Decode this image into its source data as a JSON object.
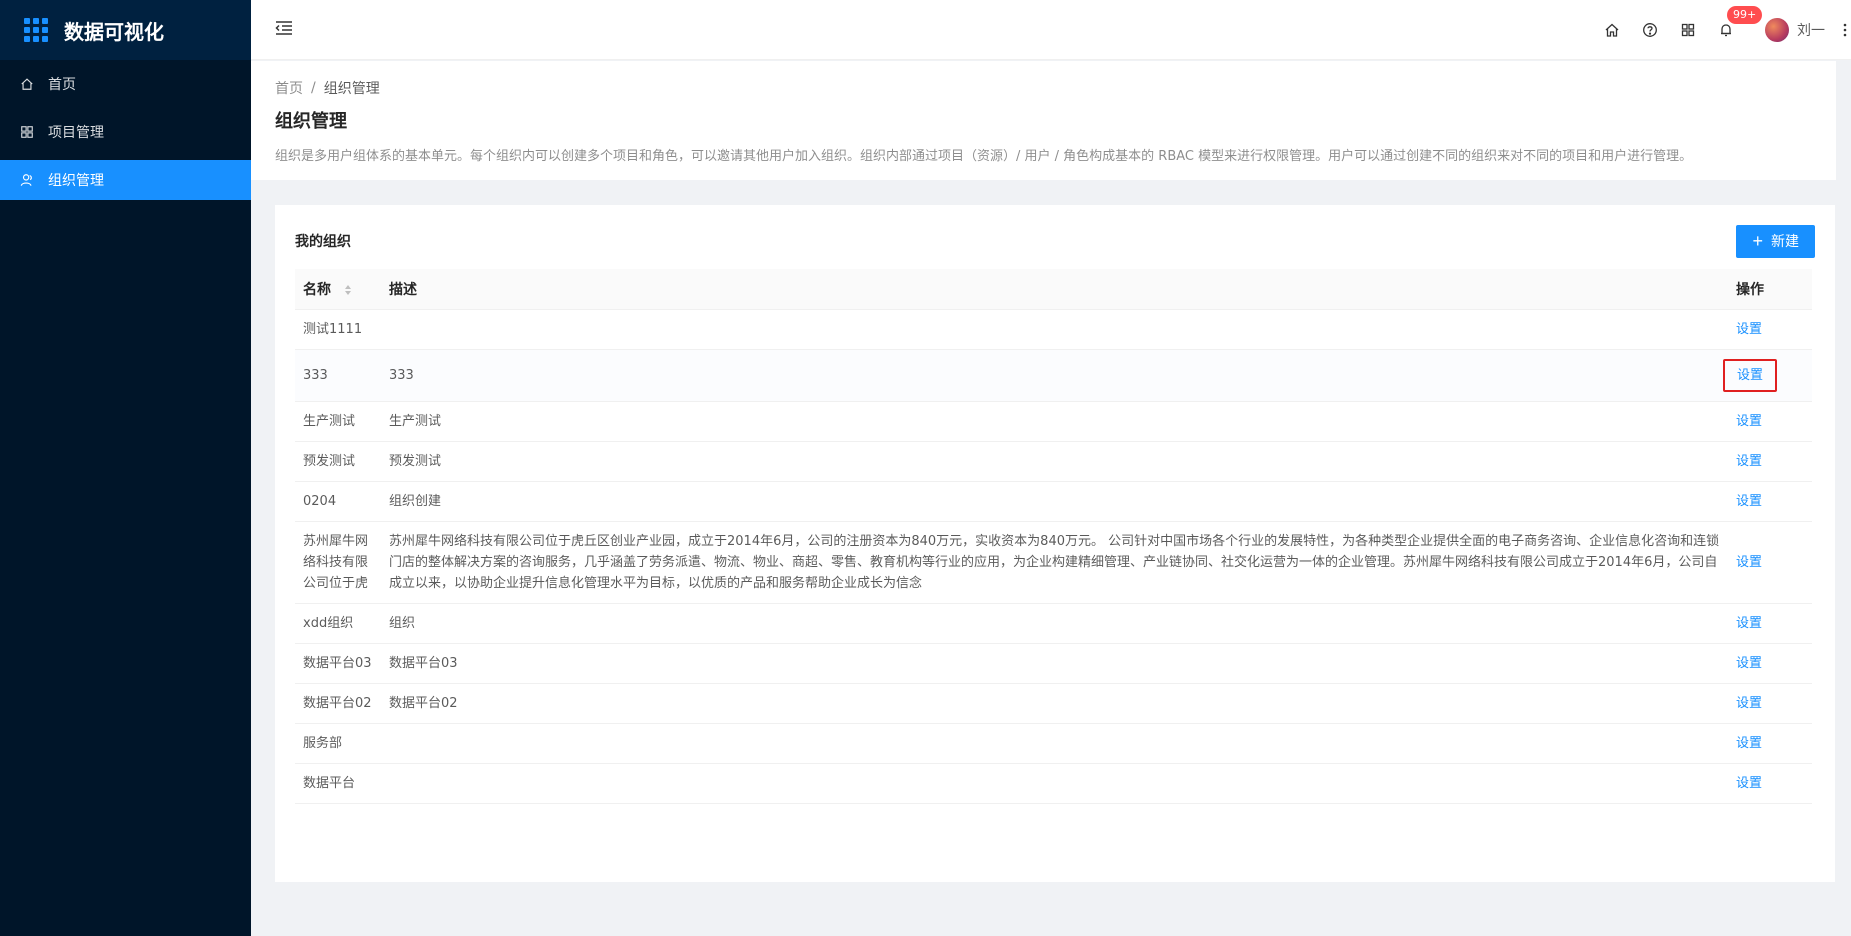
{
  "app": {
    "title": "数据可视化",
    "accent_color": "#1890ff",
    "sider_color": "#001529"
  },
  "sidebar": {
    "items": [
      {
        "label": "首页",
        "icon": "home-icon",
        "active": false
      },
      {
        "label": "项目管理",
        "icon": "grid-icon",
        "active": false
      },
      {
        "label": "组织管理",
        "icon": "team-icon",
        "active": true
      }
    ]
  },
  "header": {
    "notification_badge": "99+",
    "user_name": "刘一",
    "icons": [
      "home-icon",
      "help-icon",
      "apps-icon",
      "bell-icon",
      "more-icon"
    ]
  },
  "page": {
    "breadcrumb": [
      "首页",
      "组织管理"
    ],
    "breadcrumb_sep": "/",
    "title": "组织管理",
    "description": "组织是多用户组体系的基本单元。每个组织内可以创建多个项目和角色，可以邀请其他用户加入组织。组织内部通过项目（资源）/ 用户 / 角色构成基本的 RBAC 模型来进行权限管理。用户可以通过创建不同的组织来对不同的项目和用户进行管理。"
  },
  "card": {
    "title": "我的组织",
    "new_button": "新建"
  },
  "table": {
    "columns": {
      "name": "名称",
      "desc": "描述",
      "op": "操作"
    },
    "rows": [
      {
        "name": "测试1111",
        "desc": "",
        "op": "设置"
      },
      {
        "name": "333",
        "desc": "333",
        "op": "设置"
      },
      {
        "name": "生产测试",
        "desc": "生产测试",
        "op": "设置"
      },
      {
        "name": "预发测试",
        "desc": "预发测试",
        "op": "设置"
      },
      {
        "name": "0204",
        "desc": "组织创建",
        "op": "设置"
      },
      {
        "name": "苏州犀牛网络科技有限公司位于虎",
        "desc": "苏州犀牛网络科技有限公司位于虎丘区创业产业园，成立于2014年6月，公司的注册资本为840万元，实收资本为840万元。 公司针对中国市场各个行业的发展特性，为各种类型企业提供全面的电子商务咨询、企业信息化咨询和连锁门店的整体解决方案的咨询服务，几乎涵盖了劳务派遣、物流、物业、商超、零售、教育机构等行业的应用，为企业构建精细管理、产业链协同、社交化运营为一体的企业管理。苏州犀牛网络科技有限公司成立于2014年6月，公司自成立以来，以协助企业提升信息化管理水平为目标，以优质的产品和服务帮助企业成长为信念",
        "op": "设置"
      },
      {
        "name": "xdd组织",
        "desc": "组织",
        "op": "设置"
      },
      {
        "name": "数据平台03",
        "desc": "数据平台03",
        "op": "设置"
      },
      {
        "name": "数据平台02",
        "desc": "数据平台02",
        "op": "设置"
      },
      {
        "name": "服务部",
        "desc": "",
        "op": "设置"
      },
      {
        "name": "数据平台",
        "desc": "",
        "op": "设置"
      }
    ]
  }
}
